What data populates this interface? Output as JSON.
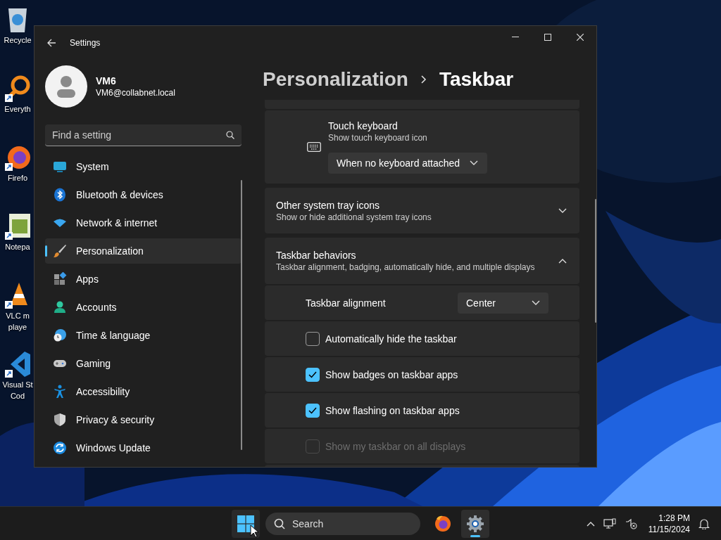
{
  "desktop_icons": [
    {
      "kind": "recycle",
      "lines": [
        "Recycle"
      ]
    },
    {
      "kind": "everything",
      "lines": [
        "Everyth"
      ]
    },
    {
      "kind": "firefox",
      "lines": [
        "Firefo"
      ]
    },
    {
      "kind": "notepad",
      "lines": [
        "Notepa"
      ]
    },
    {
      "kind": "vlc",
      "lines": [
        "VLC m",
        "playe"
      ]
    },
    {
      "kind": "vscode",
      "lines": [
        "Visual St",
        "Cod"
      ]
    }
  ],
  "window": {
    "title": "Settings"
  },
  "user": {
    "name": "VM6",
    "email": "VM6@collabnet.local"
  },
  "search": {
    "placeholder": "Find a setting"
  },
  "nav": [
    {
      "kind": "system",
      "label": "System",
      "selected": false
    },
    {
      "kind": "bluetooth",
      "label": "Bluetooth & devices",
      "selected": false
    },
    {
      "kind": "network",
      "label": "Network & internet",
      "selected": false
    },
    {
      "kind": "personalization",
      "label": "Personalization",
      "selected": true
    },
    {
      "kind": "apps",
      "label": "Apps",
      "selected": false
    },
    {
      "kind": "accounts",
      "label": "Accounts",
      "selected": false
    },
    {
      "kind": "time",
      "label": "Time & language",
      "selected": false
    },
    {
      "kind": "gaming",
      "label": "Gaming",
      "selected": false
    },
    {
      "kind": "accessibility",
      "label": "Accessibility",
      "selected": false
    },
    {
      "kind": "privacy",
      "label": "Privacy & security",
      "selected": false
    },
    {
      "kind": "update",
      "label": "Windows Update",
      "selected": false
    }
  ],
  "breadcrumb": {
    "parent": "Personalization",
    "current": "Taskbar"
  },
  "touch_keyboard": {
    "title": "Touch keyboard",
    "subtitle": "Show touch keyboard icon",
    "value": "When no keyboard attached"
  },
  "tray_icons": {
    "title": "Other system tray icons",
    "subtitle": "Show or hide additional system tray icons",
    "expanded": false
  },
  "behaviors": {
    "title": "Taskbar behaviors",
    "subtitle": "Taskbar alignment, badging, automatically hide, and multiple displays",
    "expanded": true,
    "rows": [
      {
        "kind": "dropdown",
        "label": "Taskbar alignment",
        "value": "Center"
      },
      {
        "kind": "checkbox",
        "label": "Automatically hide the taskbar",
        "checked": false,
        "disabled": false
      },
      {
        "kind": "checkbox",
        "label": "Show badges on taskbar apps",
        "checked": true,
        "disabled": false
      },
      {
        "kind": "checkbox",
        "label": "Show flashing on taskbar apps",
        "checked": true,
        "disabled": false
      },
      {
        "kind": "checkbox",
        "label": "Show my taskbar on all displays",
        "checked": false,
        "disabled": true
      }
    ]
  },
  "taskbar": {
    "search_placeholder": "Search",
    "apps": [
      {
        "kind": "firefox",
        "active": false
      },
      {
        "kind": "settings",
        "active": true
      }
    ],
    "time": "1:28 PM",
    "date": "11/15/2024"
  }
}
